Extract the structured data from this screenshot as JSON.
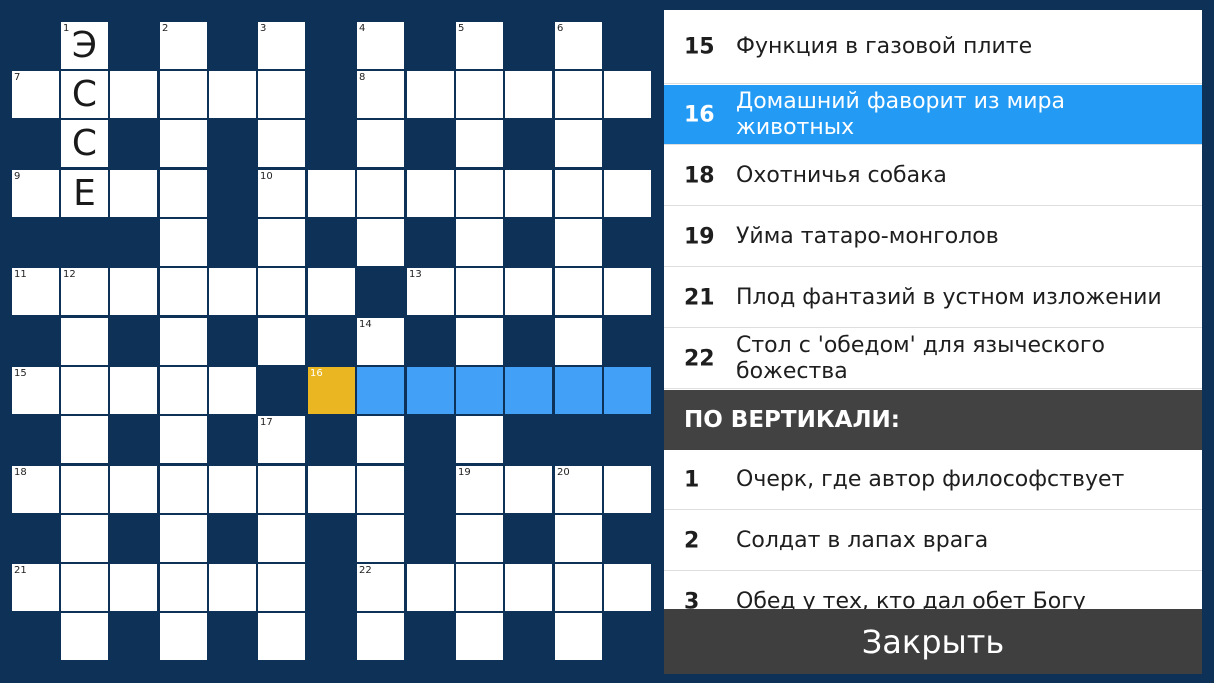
{
  "grid": {
    "numbers": {
      "1": "1",
      "2": "2",
      "3": "3",
      "4": "4",
      "5": "5",
      "6": "6",
      "7": "7",
      "8": "8",
      "9": "9",
      "10": "10",
      "11": "11",
      "12": "12",
      "13": "13",
      "14": "14",
      "15": "15",
      "16": "16",
      "17": "17",
      "18": "18",
      "19": "19",
      "20": "20",
      "21": "21",
      "22": "22"
    },
    "letters": {
      "e1": "Э",
      "s1": "С",
      "s2": "С",
      "e2": "Е"
    }
  },
  "clues": {
    "across": [
      {
        "num": "15",
        "text": "Функция в газовой плите"
      },
      {
        "num": "16",
        "text": "Домашний фаворит из мира животных"
      },
      {
        "num": "18",
        "text": "Охотничья собака"
      },
      {
        "num": "19",
        "text": "Уйма татаро-монголов"
      },
      {
        "num": "21",
        "text": "Плод фантазий в устном изложении"
      },
      {
        "num": "22",
        "text": "Стол с 'обедом' для языческого божества"
      }
    ],
    "down_header": "ПО ВЕРТИКАЛИ:",
    "down": [
      {
        "num": "1",
        "text": "Очерк, где автор философствует"
      },
      {
        "num": "2",
        "text": "Солдат в лапах врага"
      },
      {
        "num": "3",
        "text": "Обед у тех, кто дал обет Богу"
      }
    ]
  },
  "close_label": "Закрыть",
  "colors": {
    "background": "#0e3157",
    "highlight": "#42a0f7",
    "selected": "#eab621",
    "active_clue": "#239bf5",
    "section": "#424242"
  }
}
